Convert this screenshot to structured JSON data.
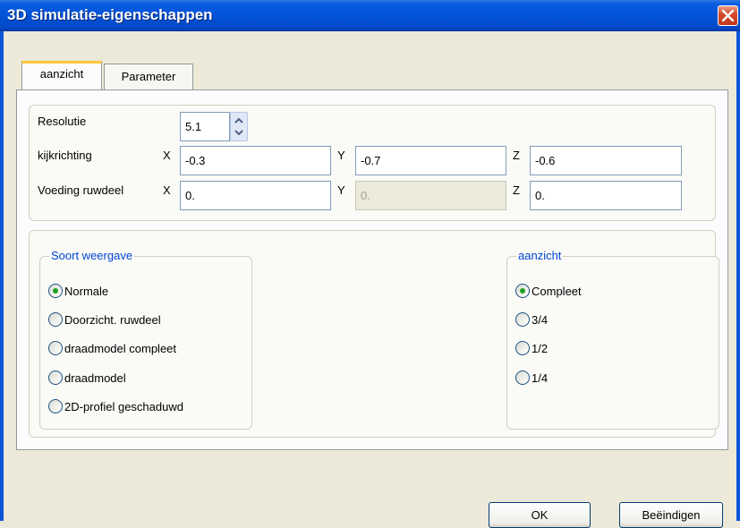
{
  "window": {
    "title": "3D simulatie-eigenschappen",
    "close_icon": "close-icon"
  },
  "tabs": [
    {
      "label": "aanzicht",
      "active": true
    },
    {
      "label": "Parameter",
      "active": false
    }
  ],
  "resolution": {
    "label": "Resolutie",
    "value": "5.1"
  },
  "view_direction": {
    "label": "kijkrichting",
    "x_label": "X",
    "x_value": "-0.3",
    "y_label": "Y",
    "y_value": "-0.7",
    "z_label": "Z",
    "z_value": "-0.6"
  },
  "stock_feed": {
    "label": "Voeding ruwdeel",
    "x_label": "X",
    "x_value": "0.",
    "y_label": "Y",
    "y_value": "0.",
    "z_label": "Z",
    "z_value": "0."
  },
  "display_type": {
    "title": "Soort weergave",
    "options": [
      {
        "label": "Normale",
        "checked": true
      },
      {
        "label": "Doorzicht. ruwdeel",
        "checked": false
      },
      {
        "label": "draadmodel compleet",
        "checked": false
      },
      {
        "label": "draadmodel",
        "checked": false
      },
      {
        "label": "2D-profiel geschaduwd",
        "checked": false
      }
    ]
  },
  "view_group": {
    "title": "aanzicht",
    "options": [
      {
        "label": "Compleet",
        "checked": true
      },
      {
        "label": "3/4",
        "checked": false
      },
      {
        "label": "1/2",
        "checked": false
      },
      {
        "label": "1/4",
        "checked": false
      }
    ]
  },
  "buttons": {
    "ok": "OK",
    "finish": "Beëindigen"
  },
  "colors": {
    "titlebar": "#0453d8",
    "group_title": "#0046d5",
    "radio_check": "#21a121",
    "close_button": "#d34b2c"
  }
}
